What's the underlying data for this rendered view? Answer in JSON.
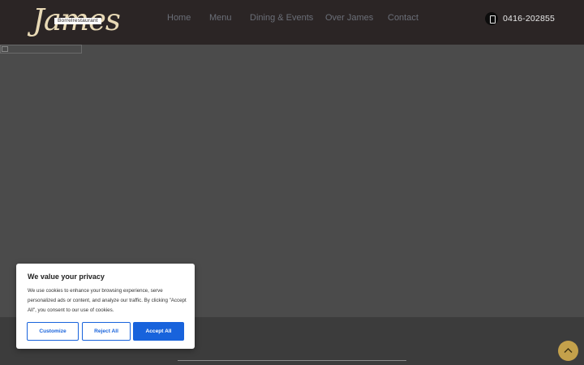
{
  "header": {
    "logo": {
      "script_text": "James",
      "tagline": "Borrelrestaurant"
    },
    "nav": [
      {
        "label": "Home"
      },
      {
        "label": "Menu"
      },
      {
        "label": "Dining & Events"
      },
      {
        "label": "Over James"
      },
      {
        "label": "Contact"
      }
    ],
    "phone": {
      "icon": "mobile-phone-icon",
      "number": "0416-202855"
    }
  },
  "cookie_banner": {
    "title": "We value your privacy",
    "text": "We use cookies to enhance your browsing experience, serve personalized ads or content, and analyze our traffic. By clicking \"Accept All\", you consent to our use of cookies.",
    "buttons": {
      "customize": "Customize",
      "reject": "Reject All",
      "accept": "Accept All"
    }
  },
  "colors": {
    "accent_blue": "#1863dc",
    "back_to_top": "#c4a14b",
    "header_bg": "#2b2525",
    "hero_bg": "#4b4b4b"
  },
  "back_to_top": {
    "icon": "chevron-up-icon"
  }
}
